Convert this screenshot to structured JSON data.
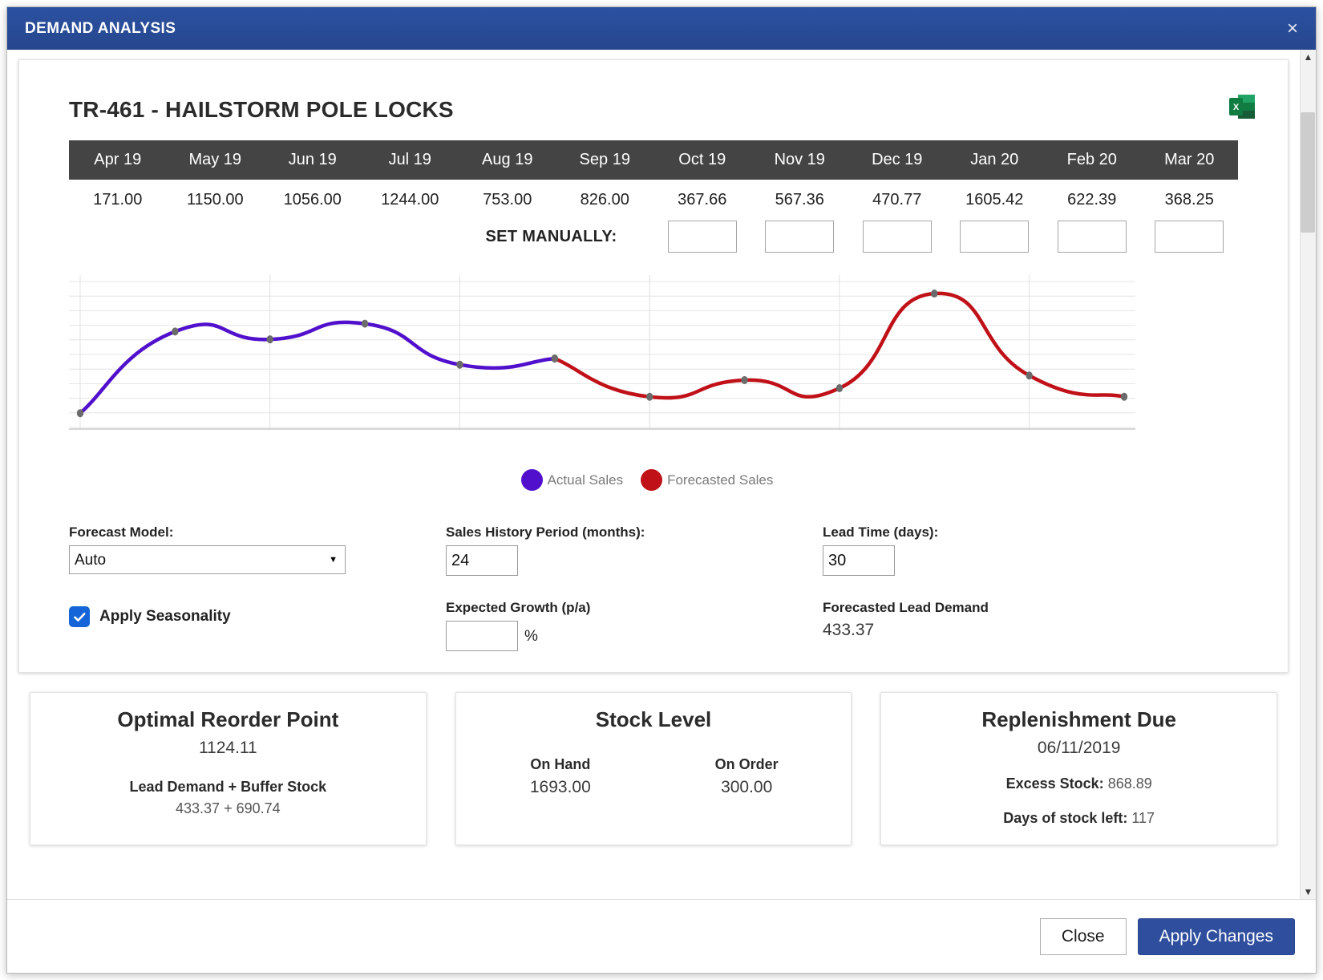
{
  "window": {
    "title": "DEMAND ANALYSIS",
    "close_icon": "close-icon",
    "accent_color": "#2a4f9c"
  },
  "product": {
    "title": "TR-461 - HAILSTORM POLE LOCKS",
    "export_icon": "excel-export-icon"
  },
  "table": {
    "months": [
      "Apr 19",
      "May 19",
      "Jun 19",
      "Jul 19",
      "Aug 19",
      "Sep 19",
      "Oct 19",
      "Nov 19",
      "Dec 19",
      "Jan 20",
      "Feb 20",
      "Mar 20"
    ],
    "values": [
      "171.00",
      "1150.00",
      "1056.00",
      "1244.00",
      "753.00",
      "826.00",
      "367.66",
      "567.36",
      "470.77",
      "1605.42",
      "622.39",
      "368.25"
    ],
    "set_manually_label": "SET MANUALLY:",
    "manual_inputs": [
      "",
      "",
      "",
      "",
      "",
      ""
    ],
    "manual_input_start_index": 6
  },
  "chart_data": {
    "type": "line",
    "title": "",
    "xlabel": "",
    "ylabel": "",
    "categories": [
      "Apr 19",
      "May 19",
      "Jun 19",
      "Jul 19",
      "Aug 19",
      "Sep 19",
      "Oct 19",
      "Nov 19",
      "Dec 19",
      "Jan 20",
      "Feb 20",
      "Mar 20"
    ],
    "series": [
      {
        "name": "Actual Sales",
        "color": "#5110cc",
        "values": [
          171.0,
          1150.0,
          1056.0,
          1244.0,
          753.0,
          826.0,
          null,
          null,
          null,
          null,
          null,
          null
        ]
      },
      {
        "name": "Forecasted Sales",
        "color": "#c01118",
        "values": [
          null,
          null,
          null,
          null,
          null,
          826.0,
          367.66,
          567.36,
          470.77,
          1605.42,
          622.39,
          368.25
        ]
      }
    ],
    "ylim": [
      0,
      1750
    ],
    "grid": true,
    "legend_position": "bottom",
    "legend": [
      {
        "label": "Actual Sales",
        "color": "#5110cc"
      },
      {
        "label": "Forecasted Sales",
        "color": "#c01118"
      }
    ],
    "marker_color": "#6b6b6b"
  },
  "controls": {
    "forecast_model_label": "Forecast Model:",
    "forecast_model_value": "Auto",
    "forecast_model_options": [
      "Auto"
    ],
    "apply_seasonality_label": "Apply Seasonality",
    "apply_seasonality_checked": true,
    "sales_history_label": "Sales History Period (months):",
    "sales_history_value": "24",
    "expected_growth_label": "Expected Growth (p/a)",
    "expected_growth_value": "",
    "percent_symbol": "%",
    "lead_time_label": "Lead Time (days):",
    "lead_time_value": "30",
    "forecasted_lead_demand_label": "Forecasted Lead Demand",
    "forecasted_lead_demand_value": "433.37"
  },
  "cards": {
    "reorder": {
      "title": "Optimal Reorder Point",
      "value": "1124.11",
      "sub_label": "Lead Demand + Buffer Stock",
      "sub_value": "433.37 + 690.74"
    },
    "stock": {
      "title": "Stock Level",
      "on_hand_label": "On Hand",
      "on_hand_value": "1693.00",
      "on_order_label": "On Order",
      "on_order_value": "300.00"
    },
    "replenishment": {
      "title": "Replenishment Due",
      "value": "06/11/2019",
      "excess_label": "Excess Stock:",
      "excess_value": "868.89",
      "days_label": "Days of stock left:",
      "days_value": "117"
    }
  },
  "footer": {
    "close_label": "Close",
    "apply_label": "Apply Changes"
  },
  "scrollbar": {
    "up_icon": "chevron-up-icon",
    "down_icon": "chevron-down-icon"
  }
}
